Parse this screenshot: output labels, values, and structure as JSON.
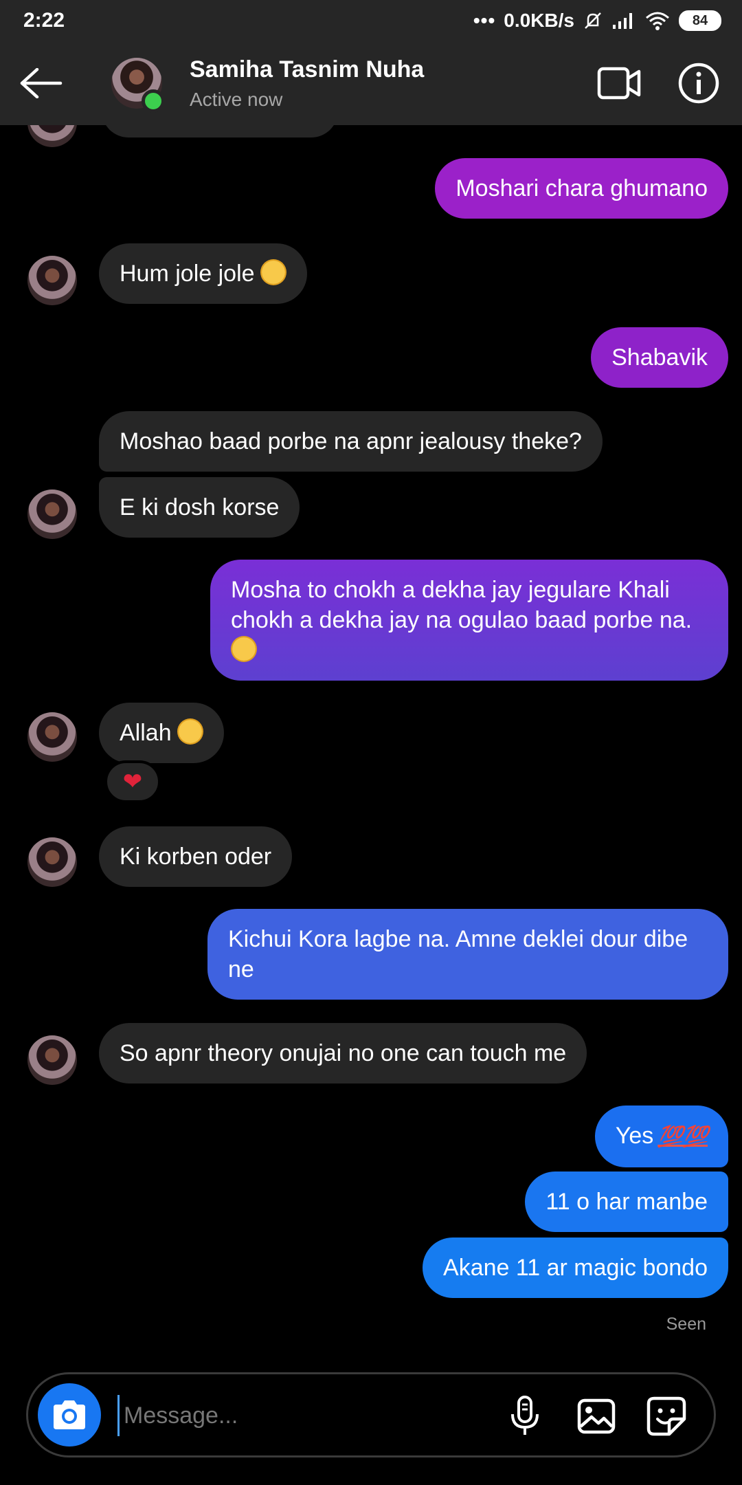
{
  "status_bar": {
    "time": "2:22",
    "net_speed": "0.0KB/s",
    "battery": "84"
  },
  "header": {
    "contact_name": "Samiha Tasnim Nuha",
    "status": "Active now"
  },
  "messages": {
    "m1": "Moshari chara ghumano",
    "m2": "Hum jole jole",
    "m3": "Shabavik",
    "m4": "Moshao baad porbe na apnr jealousy theke?",
    "m5": "E ki dosh korse",
    "m6_line1": "Mosha to chokh a dekha jay jegulare Khali",
    "m6_line2": "chokh a dekha jay na ogulao baad porbe na.",
    "m7": "Allah",
    "m8": "Ki korben oder",
    "m9_line1": "Kichui Kora lagbe na. Amne deklei dour dibe",
    "m9_line2": "ne",
    "m10": "So apnr theory onujai no one can touch me",
    "m11": "Yes",
    "m11_emoji": "💯💯",
    "m12": "11 o har manbe",
    "m13": "Akane 11 ar magic bondo",
    "seen": "Seen",
    "reaction": "❤"
  },
  "composer": {
    "placeholder": "Message..."
  },
  "colors": {
    "bar_bg": "#262626",
    "incoming": "#262626",
    "online": "#3ccf4e",
    "camera": "#1877f2"
  }
}
